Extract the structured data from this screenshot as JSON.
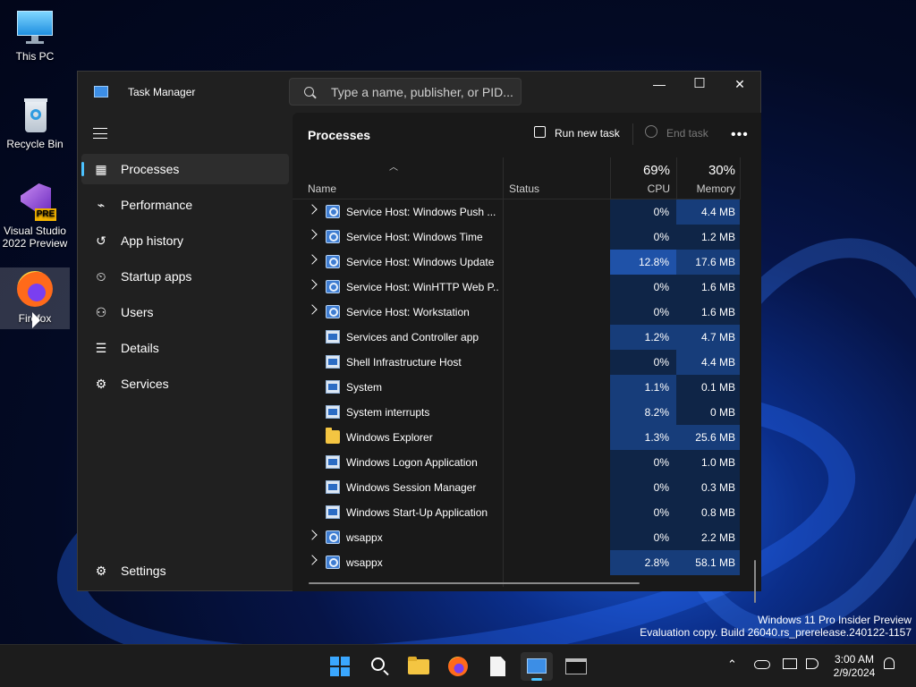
{
  "desktop": {
    "icons": [
      {
        "label": "This PC"
      },
      {
        "label": "Recycle Bin"
      },
      {
        "label": "Visual Studio 2022 Preview",
        "badge": "PRE"
      },
      {
        "label": "Firefox"
      }
    ],
    "watermark": {
      "line1": "Windows 11 Pro Insider Preview",
      "line2": "Evaluation copy. Build 26040.rs_prerelease.240122-1157"
    }
  },
  "window": {
    "title": "Task Manager",
    "search_placeholder": "Type a name, publisher, or PID...",
    "controls": {
      "minimize": "—",
      "maximize": "☐",
      "close": "✕"
    }
  },
  "sidebar": {
    "items": [
      {
        "label": "Processes",
        "icon": "processes-icon",
        "glyph": "▦"
      },
      {
        "label": "Performance",
        "icon": "performance-icon",
        "glyph": "⌁"
      },
      {
        "label": "App history",
        "icon": "app-history-icon",
        "glyph": "↺"
      },
      {
        "label": "Startup apps",
        "icon": "startup-icon",
        "glyph": "⏲"
      },
      {
        "label": "Users",
        "icon": "users-icon",
        "glyph": "⚇"
      },
      {
        "label": "Details",
        "icon": "details-icon",
        "glyph": "☰"
      },
      {
        "label": "Services",
        "icon": "services-icon",
        "glyph": "⚙"
      }
    ],
    "settings": {
      "label": "Settings",
      "glyph": "⚙"
    }
  },
  "main": {
    "title": "Processes",
    "run_new_task": "Run new task",
    "end_task": "End task",
    "more": "•••",
    "columns": {
      "name": "Name",
      "status": "Status",
      "cpu_pct": "69%",
      "cpu": "CPU",
      "mem_pct": "30%",
      "memory": "Memory"
    },
    "rows": [
      {
        "name": "Service Host: Windows Push ...",
        "icon": "gear",
        "expand": true,
        "cpu": "0%",
        "mem": "4.4 MB",
        "cpu_heat": 0,
        "mem_heat": 1
      },
      {
        "name": "Service Host: Windows Time",
        "icon": "gear",
        "expand": true,
        "cpu": "0%",
        "mem": "1.2 MB",
        "cpu_heat": 0,
        "mem_heat": 0
      },
      {
        "name": "Service Host: Windows Update",
        "icon": "gear",
        "expand": true,
        "cpu": "12.8%",
        "mem": "17.6 MB",
        "cpu_heat": 2,
        "mem_heat": 1
      },
      {
        "name": "Service Host: WinHTTP Web P...",
        "icon": "gear",
        "expand": true,
        "cpu": "0%",
        "mem": "1.6 MB",
        "cpu_heat": 0,
        "mem_heat": 0
      },
      {
        "name": "Service Host: Workstation",
        "icon": "gear",
        "expand": true,
        "cpu": "0%",
        "mem": "1.6 MB",
        "cpu_heat": 0,
        "mem_heat": 0
      },
      {
        "name": "Services and Controller app",
        "icon": "win",
        "expand": false,
        "cpu": "1.2%",
        "mem": "4.7 MB",
        "cpu_heat": 1,
        "mem_heat": 1
      },
      {
        "name": "Shell Infrastructure Host",
        "icon": "win",
        "expand": false,
        "cpu": "0%",
        "mem": "4.4 MB",
        "cpu_heat": 0,
        "mem_heat": 1
      },
      {
        "name": "System",
        "icon": "win",
        "expand": false,
        "cpu": "1.1%",
        "mem": "0.1 MB",
        "cpu_heat": 1,
        "mem_heat": 0
      },
      {
        "name": "System interrupts",
        "icon": "win",
        "expand": false,
        "cpu": "8.2%",
        "mem": "0 MB",
        "cpu_heat": 1,
        "mem_heat": 0
      },
      {
        "name": "Windows Explorer",
        "icon": "folder",
        "expand": false,
        "cpu": "1.3%",
        "mem": "25.6 MB",
        "cpu_heat": 1,
        "mem_heat": 1
      },
      {
        "name": "Windows Logon Application",
        "icon": "win",
        "expand": false,
        "cpu": "0%",
        "mem": "1.0 MB",
        "cpu_heat": 0,
        "mem_heat": 0
      },
      {
        "name": "Windows Session Manager",
        "icon": "win",
        "expand": false,
        "cpu": "0%",
        "mem": "0.3 MB",
        "cpu_heat": 0,
        "mem_heat": 0
      },
      {
        "name": "Windows Start-Up Application",
        "icon": "win",
        "expand": false,
        "cpu": "0%",
        "mem": "0.8 MB",
        "cpu_heat": 0,
        "mem_heat": 0
      },
      {
        "name": "wsappx",
        "icon": "gear",
        "expand": true,
        "cpu": "0%",
        "mem": "2.2 MB",
        "cpu_heat": 0,
        "mem_heat": 0
      },
      {
        "name": "wsappx",
        "icon": "gear",
        "expand": true,
        "cpu": "2.8%",
        "mem": "58.1 MB",
        "cpu_heat": 1,
        "mem_heat": 1
      }
    ]
  },
  "heat_colors": [
    "#0f2547",
    "#173d7a",
    "#1f52a8"
  ],
  "taskbar": {
    "clock_time": "3:00 AM",
    "clock_date": "2/9/2024",
    "tray_chevron": "⌃"
  }
}
